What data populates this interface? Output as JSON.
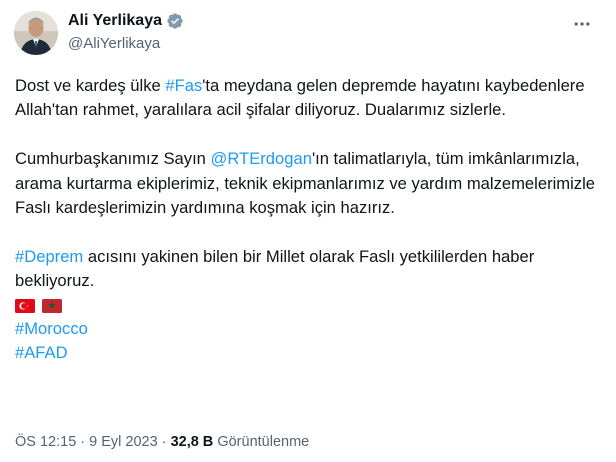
{
  "author": {
    "name": "Ali Yerlikaya",
    "handle": "@AliYerlikaya",
    "verified": true,
    "avatar_icon": "profile-photo"
  },
  "tweet": {
    "p1": {
      "pre": "Dost ve kardeş ülke ",
      "tag": "#Fas",
      "post": "'ta meydana gelen depremde hayatını kaybedenlere Allah'tan rahmet, yaralılara acil şifalar diliyoruz. Dualarımız sizlerle."
    },
    "p2": {
      "pre": "Cumhurbaşkanımız Sayın ",
      "mention": "@RTErdogan",
      "post": "'ın talimatlarıyla, tüm imkânlarımızla, arama kurtarma ekiplerimiz, teknik ekipmanlarımız ve yardım malzemelerimizle Faslı kardeşlerimizin yardımına koşmak için hazırız."
    },
    "p3": {
      "tag": "#Deprem",
      "post": " acısını yakinen bilen bir Millet olarak Faslı yetkililerden haber bekliyoruz."
    },
    "flags": [
      "turkey-flag",
      "morocco-flag"
    ],
    "hashtag_morocco": "#Morocco",
    "hashtag_afad": "#AFAD"
  },
  "meta": {
    "time_date": "ÖS 12:15 · 9 Eyl 2023 · ",
    "views_count": "32,8 B",
    "views_label": "Görüntülenme"
  },
  "colors": {
    "link": "#1d9bf0",
    "text": "#0f1419",
    "secondary": "#536471"
  }
}
